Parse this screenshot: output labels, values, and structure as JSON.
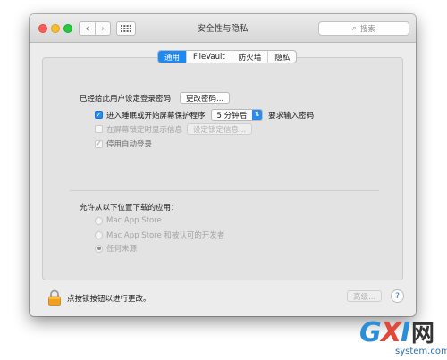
{
  "window": {
    "title": "安全性与隐私"
  },
  "search": {
    "placeholder": "搜索"
  },
  "tabs": [
    {
      "label": "通用",
      "active": true
    },
    {
      "label": "FileVault",
      "active": false
    },
    {
      "label": "防火墙",
      "active": false
    },
    {
      "label": "隐私",
      "active": false
    }
  ],
  "general": {
    "password_label": "已经给此用户设定登录密码",
    "change_password_button": "更改密码...",
    "require_password": {
      "checked": true,
      "label_before": "进入睡眠或开始屏幕保护程序",
      "delay_value": "5 分钟后",
      "label_after": "要求输入密码"
    },
    "lock_message": {
      "checked": false,
      "label": "在屏幕锁定时显示信息",
      "button": "设定锁定信息..."
    },
    "disable_auto_login": {
      "checked": true,
      "label": "停用自动登录"
    }
  },
  "downloads": {
    "heading": "允许从以下位置下载的应用：",
    "options": [
      {
        "label": "Mac App Store",
        "selected": false
      },
      {
        "label": "Mac App Store 和被认可的开发者",
        "selected": false
      },
      {
        "label": "任何来源",
        "selected": true
      }
    ]
  },
  "footer": {
    "lock_text": "点按锁按钮以进行更改。",
    "advanced_button": "高级...",
    "help_button": "?"
  },
  "watermark": {
    "brand_text": "GXI网",
    "site_text": "system.com"
  },
  "colors": {
    "accent": "#1d8af2",
    "close": "#fc5f57",
    "minimize": "#fdbc2e",
    "maximize": "#28c840",
    "lock": "#f0a01e"
  },
  "icons": [
    "back-chevron-icon",
    "forward-chevron-icon",
    "grid-icon",
    "search-icon",
    "lock-icon",
    "help-icon"
  ]
}
